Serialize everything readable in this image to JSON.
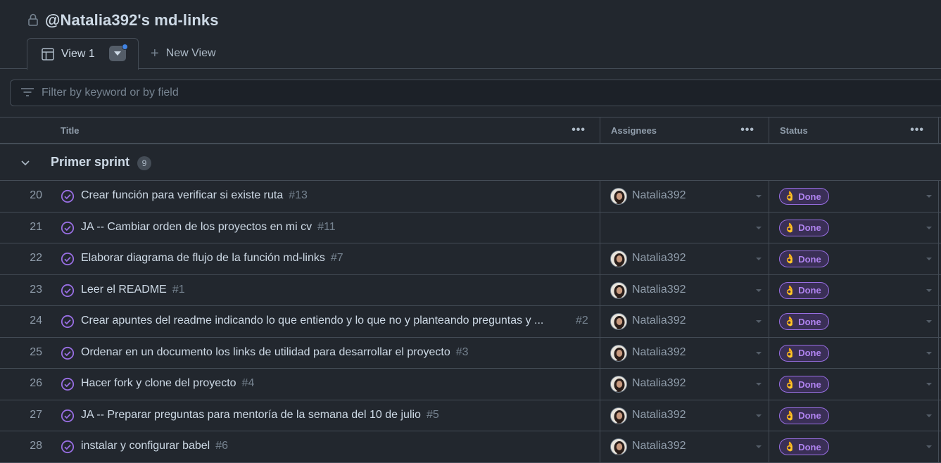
{
  "project": {
    "title": "@Natalia392's md-links"
  },
  "tabs": {
    "active_label": "View 1",
    "new_view_label": "New View"
  },
  "filter": {
    "placeholder": "Filter by keyword or by field"
  },
  "columns": {
    "title": "Title",
    "assignees": "Assignees",
    "status": "Status"
  },
  "group": {
    "name": "Primer sprint",
    "count": "9"
  },
  "colors": {
    "background": "#22272e",
    "done_badge": "#b083f0",
    "accent_dot": "#4184e4"
  },
  "rows": [
    {
      "num": "20",
      "title": "Crear función para verificar si existe ruta",
      "issue": "#13",
      "assignee": "Natalia392",
      "status": "Done",
      "status_emoji": "👌"
    },
    {
      "num": "21",
      "title": "JA -- Cambiar orden de los proyectos en mi cv",
      "issue": "#11",
      "assignee": "",
      "status": "Done",
      "status_emoji": "👌"
    },
    {
      "num": "22",
      "title": "Elaborar diagrama de flujo de la función md-links",
      "issue": "#7",
      "assignee": "Natalia392",
      "status": "Done",
      "status_emoji": "👌"
    },
    {
      "num": "23",
      "title": "Leer el README",
      "issue": "#1",
      "assignee": "Natalia392",
      "status": "Done",
      "status_emoji": "👌"
    },
    {
      "num": "24",
      "title": "Crear apuntes del readme indicando lo que entiendo y lo que no y planteando preguntas y ...",
      "issue": "#2",
      "assignee": "Natalia392",
      "status": "Done",
      "status_emoji": "👌"
    },
    {
      "num": "25",
      "title": "Ordenar en un documento los links de utilidad para desarrollar el proyecto",
      "issue": "#3",
      "assignee": "Natalia392",
      "status": "Done",
      "status_emoji": "👌"
    },
    {
      "num": "26",
      "title": "Hacer fork y clone del proyecto",
      "issue": "#4",
      "assignee": "Natalia392",
      "status": "Done",
      "status_emoji": "👌"
    },
    {
      "num": "27",
      "title": "JA -- Preparar preguntas para mentoría de la semana del 10 de julio",
      "issue": "#5",
      "assignee": "Natalia392",
      "status": "Done",
      "status_emoji": "👌"
    },
    {
      "num": "28",
      "title": "instalar y configurar babel",
      "issue": "#6",
      "assignee": "Natalia392",
      "status": "Done",
      "status_emoji": "👌"
    }
  ]
}
